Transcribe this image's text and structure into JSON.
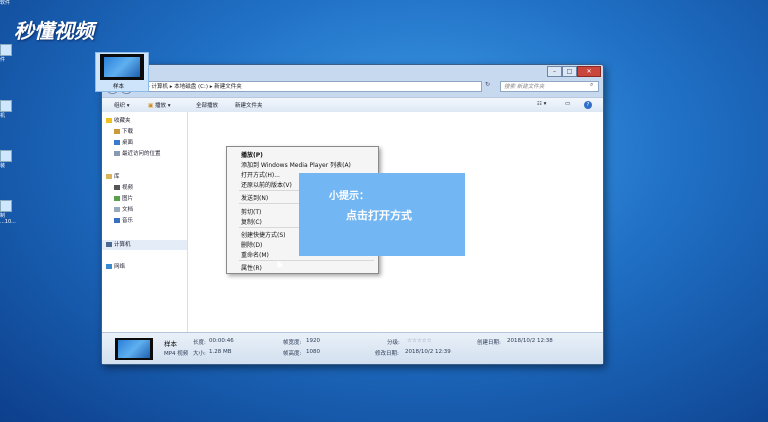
{
  "desktop": {
    "logo": "秒懂视频",
    "icons": [
      "软件",
      "件",
      "机",
      "装",
      "制\n...10..."
    ]
  },
  "window": {
    "address": "▸ 计算机 ▸ 本地磁盘 (C:) ▸ 新建文件夹",
    "search_placeholder": "搜索 新建文件夹",
    "toolbar": {
      "organize": "组织 ▾",
      "play": "播放 ▾",
      "play_all": "全部播放",
      "new_folder": "新建文件夹"
    },
    "nav": {
      "favorites": "收藏夹",
      "downloads": "下载",
      "desktop": "桌面",
      "recent": "最近访问的位置",
      "libraries": "库",
      "videos": "视频",
      "pictures": "图片",
      "documents": "文档",
      "music": "音乐",
      "computer": "计算机",
      "network": "网络"
    },
    "file": {
      "name": "样本"
    },
    "details": {
      "name": "样本",
      "type": "MP4 视频",
      "length_label": "长度:",
      "length": "00:00:46",
      "size_label": "大小:",
      "size": "1.28 MB",
      "width_label": "帧宽度:",
      "width": "1920",
      "height_label": "帧高度:",
      "height": "1080",
      "rating_label": "分级:",
      "rating": "☆☆☆☆☆",
      "modified_label": "修改日期:",
      "modified": "2018/10/2 12:39",
      "created_label": "创建日期:",
      "created": "2018/10/2 12:38"
    }
  },
  "context_menu": {
    "items": [
      "播放(P)",
      "添加到 Windows Media Player 列表(A)",
      "打开方式(H)...",
      "还原以前的版本(V)",
      "发送到(N)",
      "剪切(T)",
      "复制(C)",
      "创建快捷方式(S)",
      "删除(D)",
      "重命名(M)",
      "属性(R)"
    ]
  },
  "tip": {
    "title": "小提示：",
    "body": "点击打开方式"
  },
  "colors": {
    "tip_bg": "#72b6f3",
    "desktop": "#1f6fc4"
  }
}
